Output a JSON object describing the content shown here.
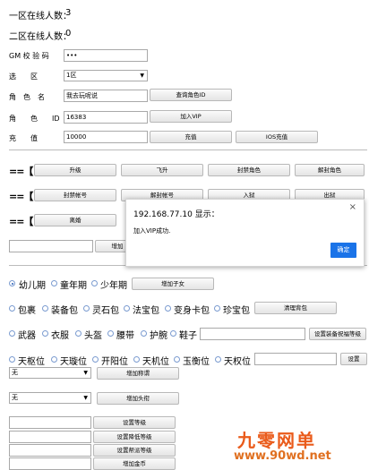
{
  "status": {
    "zone1_label": "一区在线人数：",
    "zone1_value": "3",
    "zone2_label": "二区在线人数：",
    "zone2_value": "0"
  },
  "form": {
    "gm_label": "GM 校 验 码",
    "gm_value": "•••",
    "zone_label": "选　　区",
    "zone_value": "1区",
    "role_name_label": "角　色　名",
    "role_name_value": "我去玩呢说",
    "query_id_button": "查询角色ID",
    "role_id_label": "角　　色　　ID",
    "role_id_value": "16383",
    "add_vip_button": "加入VIP",
    "recharge_label": "充　　值",
    "recharge_value": "10000",
    "recharge_button": "充值",
    "ios_recharge_button": "IOS充值"
  },
  "rows": {
    "row1": [
      "升级",
      "飞升",
      "封禁角色",
      "解封角色"
    ],
    "row2": [
      "封禁帐号",
      "解封帐号",
      "入狱",
      "出狱"
    ],
    "row3_first": "离婚",
    "misc_button": "增加"
  },
  "growth": {
    "options": [
      "幼儿期",
      "童年期",
      "少年期"
    ],
    "add_child_button": "增加子女"
  },
  "bags": {
    "options": [
      "包裹",
      "装备包",
      "灵石包",
      "法宝包",
      "变身卡包",
      "珍宝包"
    ],
    "clear_button": "清理背包"
  },
  "equipment": {
    "options": [
      "武器",
      "衣服",
      "头盔",
      "腰带",
      "护腕",
      "鞋子"
    ],
    "button": "设置装备祝福等级"
  },
  "positions": {
    "options": [
      "天枢位",
      "天璇位",
      "开阳位",
      "天机位",
      "玉衡位",
      "天权位"
    ],
    "button": "设置"
  },
  "title_select": {
    "value": "无",
    "button": "增加称谓"
  },
  "head_select": {
    "value": "无",
    "button": "增加头衔"
  },
  "levels": {
    "buttons": [
      "设置等级",
      "设置降低等级",
      "设置帮派等级",
      "增加金币"
    ]
  },
  "dialog": {
    "title": "192.168.77.10 显示：",
    "message": "加入VIP成功.",
    "ok_button": "确定",
    "close": "×"
  },
  "watermark": {
    "brand": "九零网单",
    "url": "www.90wd.net"
  }
}
